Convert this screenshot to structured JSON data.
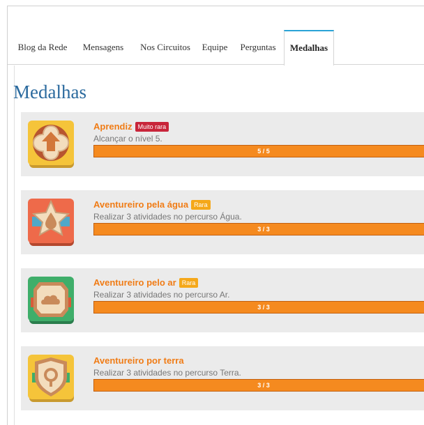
{
  "tabs": [
    {
      "label": "Blog da Rede",
      "active": false
    },
    {
      "label": "Mensagens",
      "active": false
    },
    {
      "label": "Nos Circuitos",
      "active": false
    },
    {
      "label": "Equipe",
      "active": false
    },
    {
      "label": "Perguntas",
      "active": false
    },
    {
      "label": "Medalhas",
      "active": true
    }
  ],
  "page": {
    "title": "Medalhas"
  },
  "medals": [
    {
      "name": "Aprendiz",
      "rarity": "Muito rara",
      "rarity_color": "#c8253a",
      "description": "Alcançar o nível 5.",
      "progress_text": "5 / 5",
      "progress_fraction": 1.0,
      "icon": "arrow-up-icon",
      "icon_color": "#f5c43a"
    },
    {
      "name": "Aventureiro pela água",
      "rarity": "Rara",
      "rarity_color": "#f5a81a",
      "description": "Realizar 3 atividades no percurso Água.",
      "progress_text": "3 / 3",
      "progress_fraction": 1.0,
      "icon": "water-drop-icon",
      "icon_color": "#ee6a4a"
    },
    {
      "name": "Aventureiro pelo ar",
      "rarity": "Rara",
      "rarity_color": "#f5a81a",
      "description": "Realizar 3 atividades no percurso Ar.",
      "progress_text": "3 / 3",
      "progress_fraction": 1.0,
      "icon": "cloud-icon",
      "icon_color": "#3fae6a"
    },
    {
      "name": "Aventureiro por terra",
      "rarity": "",
      "rarity_color": "",
      "description": "Realizar 3 atividades no percurso Terra.",
      "progress_text": "3 / 3",
      "progress_fraction": 1.0,
      "icon": "tree-icon",
      "icon_color": "#f5c43a"
    }
  ],
  "colors": {
    "accent_tab": "#29a3d6",
    "title": "#2b6a9e",
    "medal_name": "#f07c16",
    "progress": "#f58a1f"
  }
}
